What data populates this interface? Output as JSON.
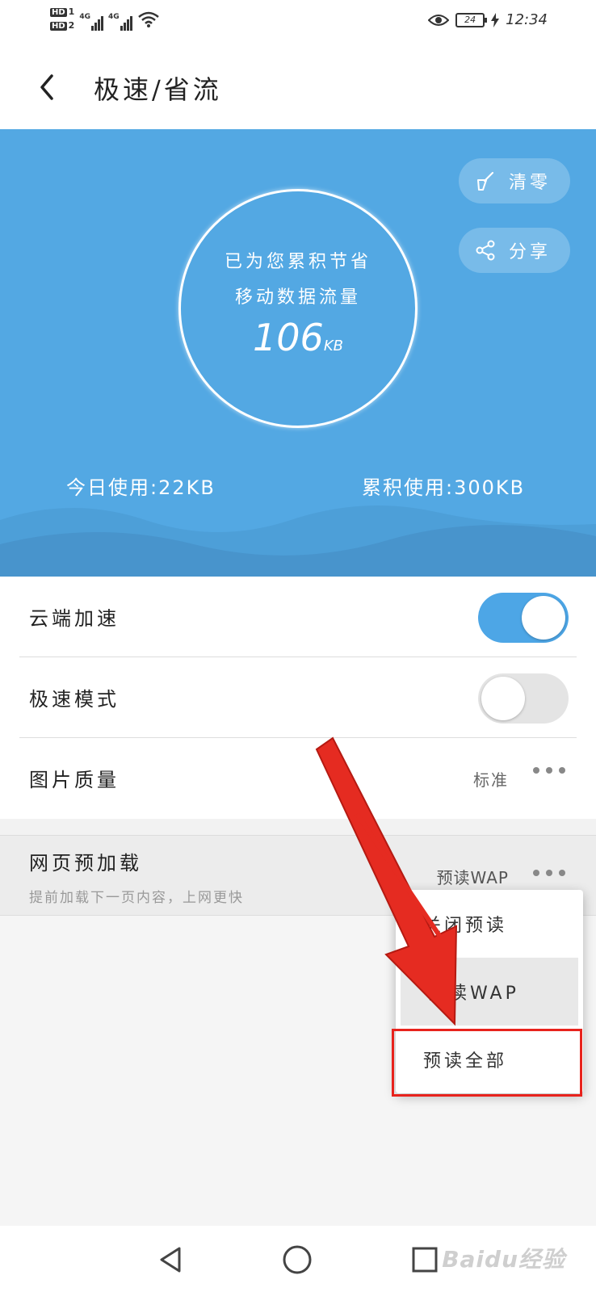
{
  "status_bar": {
    "hd1": "HD",
    "hd1_sub": "1",
    "hd2": "HD",
    "hd2_sub": "2",
    "net1": "4G",
    "net2": "4G",
    "battery": "24",
    "time": "12:34"
  },
  "header": {
    "title": "极速/省流"
  },
  "hero": {
    "circle_line1": "已为您累积节省",
    "circle_line2": "移动数据流量",
    "saved_value": "106",
    "saved_unit": "KB",
    "clear_label": "清零",
    "share_label": "分享",
    "today_usage": "今日使用:22KB",
    "total_usage": "累积使用:300KB",
    "accent_color": "#53a8e3"
  },
  "settings": {
    "cloud_accel_label": "云端加速",
    "cloud_accel_on": true,
    "speed_mode_label": "极速模式",
    "speed_mode_on": false,
    "image_quality_label": "图片质量",
    "image_quality_value": "标准"
  },
  "preload": {
    "label": "网页预加载",
    "description": "提前加载下一页内容，上网更快",
    "value": "预读WAP"
  },
  "popup_menu": {
    "items": [
      "关闭预读",
      "预读WAP",
      "预读全部"
    ],
    "selected": "预读WAP",
    "highlighted": "预读全部"
  },
  "watermark": "Baidu经验"
}
